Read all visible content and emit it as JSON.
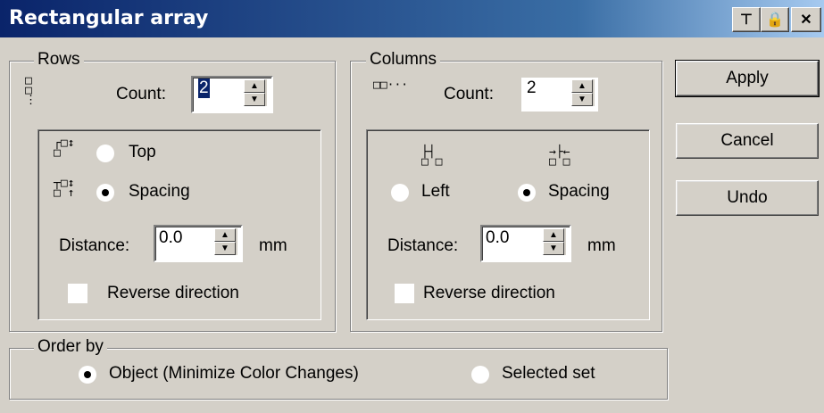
{
  "window": {
    "title": "Rectangular array"
  },
  "rows": {
    "group_label": "Rows",
    "count_label": "Count:",
    "count_value": "2",
    "top_label": "Top",
    "spacing_label": "Spacing",
    "distance_label": "Distance:",
    "distance_value": "0.0",
    "unit": "mm",
    "reverse_label": "Reverse direction"
  },
  "columns": {
    "group_label": "Columns",
    "count_label": "Count:",
    "count_value": "2",
    "left_label": "Left",
    "spacing_label": "Spacing",
    "distance_label": "Distance:",
    "distance_value": "0.0",
    "unit": "mm",
    "reverse_label": "Reverse direction"
  },
  "order": {
    "group_label": "Order by",
    "object_label": "Object (Minimize Color Changes)",
    "selected_label": "Selected set"
  },
  "buttons": {
    "apply": "Apply",
    "cancel": "Cancel",
    "undo": "Undo"
  }
}
